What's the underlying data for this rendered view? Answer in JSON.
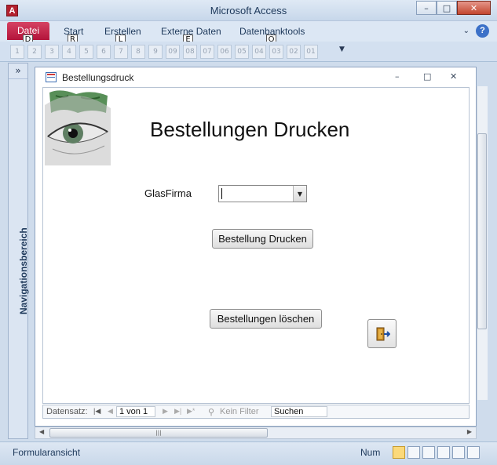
{
  "window": {
    "title": "Microsoft Access",
    "minimize": "–",
    "maximize": "□",
    "close": "✕"
  },
  "ribbon": {
    "tabs": [
      {
        "label": "Datei",
        "keytip": "D"
      },
      {
        "label": "Start",
        "keytip": "R"
      },
      {
        "label": "Erstellen",
        "keytip": "L"
      },
      {
        "label": "Externe Daten",
        "keytip": "E"
      },
      {
        "label": "Datenbanktools",
        "keytip": "O"
      }
    ],
    "minimize_icon": "chevron-down-icon",
    "help_label": "?"
  },
  "quick_access": {
    "keytips": [
      "1",
      "2",
      "3",
      "4",
      "5",
      "6",
      "7",
      "8",
      "9",
      "09",
      "08",
      "07",
      "06",
      "05",
      "04",
      "03",
      "02",
      "01"
    ],
    "more_label": "▼"
  },
  "nav_pane": {
    "label": "Navigationsbereich",
    "toggle": "»"
  },
  "document": {
    "title": "Bestellungsdruck",
    "min_label": "–",
    "max_label": "□",
    "close_label": "✕"
  },
  "form": {
    "heading": "Bestellungen Drucken",
    "glasfirma_label": "GlasFirma",
    "glasfirma_value": "",
    "print_button": "Bestellung Drucken",
    "delete_button": "Bestellungen löschen",
    "exit_icon": "exit-door-icon"
  },
  "record_nav": {
    "label": "Datensatz:",
    "position": "1 von 1",
    "filter": "Kein Filter",
    "search": "Suchen"
  },
  "statusbar": {
    "left": "Formularansicht",
    "num": "Num"
  }
}
